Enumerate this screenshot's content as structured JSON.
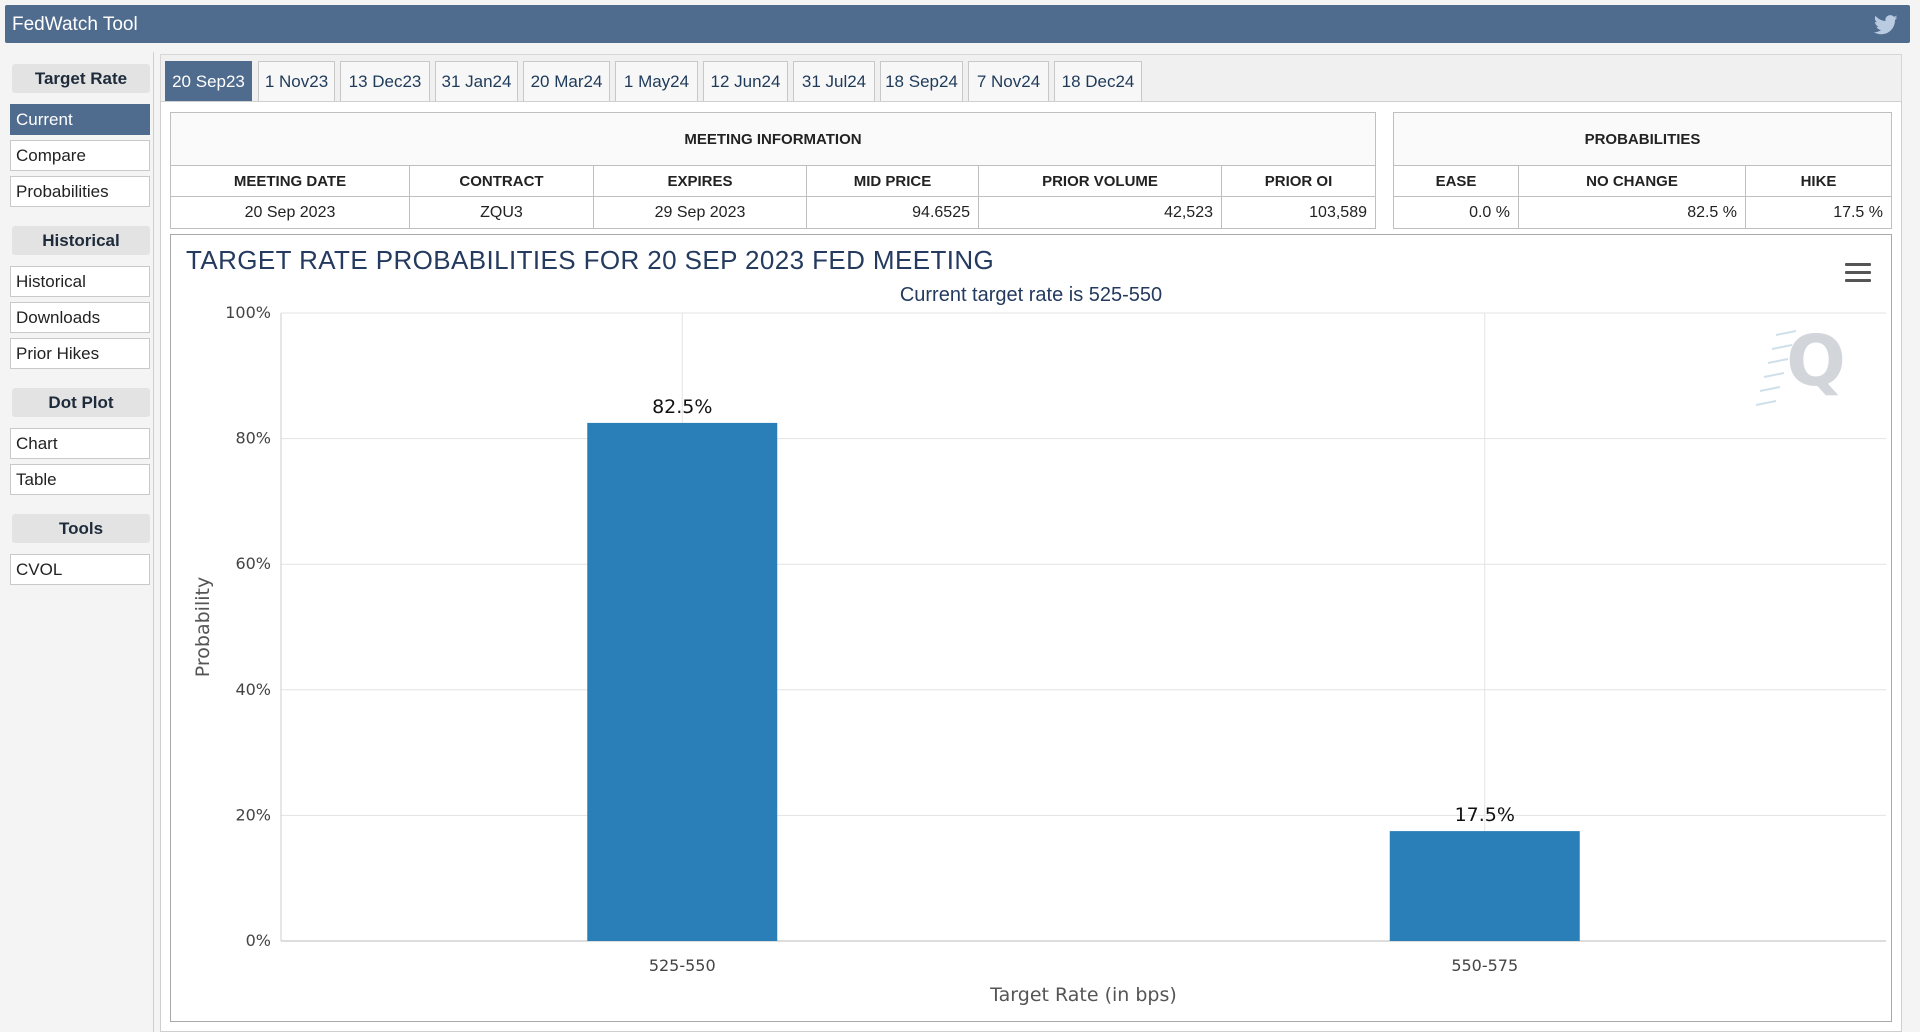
{
  "app": {
    "title": "FedWatch Tool"
  },
  "sidebar": {
    "groups": [
      {
        "heading": "Target Rate",
        "items": [
          "Current",
          "Compare",
          "Probabilities"
        ]
      },
      {
        "heading": "Historical",
        "items": [
          "Historical",
          "Downloads",
          "Prior Hikes"
        ]
      },
      {
        "heading": "Dot Plot",
        "items": [
          "Chart",
          "Table"
        ]
      },
      {
        "heading": "Tools",
        "items": [
          "CVOL"
        ]
      }
    ],
    "active_item": "Current"
  },
  "tabs": [
    "20 Sep23",
    "1 Nov23",
    "13 Dec23",
    "31 Jan24",
    "20 Mar24",
    "1 May24",
    "12 Jun24",
    "31 Jul24",
    "18 Sep24",
    "7 Nov24",
    "18 Dec24"
  ],
  "active_tab": "20 Sep23",
  "meeting_info": {
    "heading": "MEETING INFORMATION",
    "columns": [
      "MEETING DATE",
      "CONTRACT",
      "EXPIRES",
      "MID PRICE",
      "PRIOR VOLUME",
      "PRIOR OI"
    ],
    "values": [
      "20 Sep 2023",
      "ZQU3",
      "29 Sep 2023",
      "94.6525",
      "42,523",
      "103,589"
    ]
  },
  "probabilities": {
    "heading": "PROBABILITIES",
    "columns": [
      "EASE",
      "NO CHANGE",
      "HIKE"
    ],
    "values": [
      "0.0 %",
      "82.5 %",
      "17.5 %"
    ]
  },
  "chart": {
    "title": "TARGET RATE PROBABILITIES FOR 20 SEP 2023 FED MEETING",
    "subtitle": "Current target rate is 525-550"
  },
  "chart_data": {
    "type": "bar",
    "title": "TARGET RATE PROBABILITIES FOR 20 SEP 2023 FED MEETING",
    "subtitle": "Current target rate is 525-550",
    "categories": [
      "525-550",
      "550-575"
    ],
    "values": [
      82.5,
      17.5
    ],
    "data_labels": [
      "82.5%",
      "17.5%"
    ],
    "xlabel": "Target Rate (in bps)",
    "ylabel": "Probability",
    "ylim": [
      0,
      100
    ],
    "yticks": [
      "0%",
      "20%",
      "40%",
      "60%",
      "80%",
      "100%"
    ],
    "bar_color": "#2a7fb8",
    "grid": true
  },
  "colors": {
    "header": "#4f6b8d",
    "accent_text": "#243a5e"
  }
}
